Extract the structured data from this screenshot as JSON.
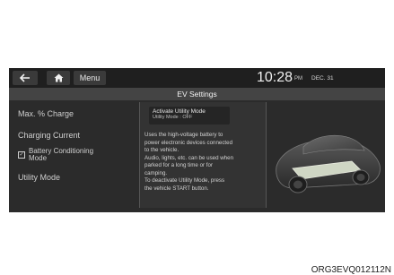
{
  "topbar": {
    "menu_label": "Menu",
    "time": "10:28",
    "ampm": "PM",
    "date": "DEC. 31"
  },
  "title": "EV Settings",
  "menu": {
    "items": [
      "Max. % Charge",
      "Charging Current",
      "Battery Conditioning",
      "Mode",
      "Utility Mode"
    ]
  },
  "utility": {
    "title": "Activate Utility Mode",
    "status": "Utility Mode : OFF"
  },
  "description": [
    "Uses the high-voltage battery to",
    "power electronic devices connected",
    "to the vehicle.",
    "Audio, lights, etc. can be used when",
    "parked for a long time or for",
    "camping.",
    "To deactivate Utility Mode, press",
    "the vehicle START button."
  ],
  "caption": "ORG3EVQ012112N",
  "icons": {
    "back": "back-arrow-icon",
    "home": "home-icon",
    "checkbox": "checkbox-checked-icon"
  }
}
